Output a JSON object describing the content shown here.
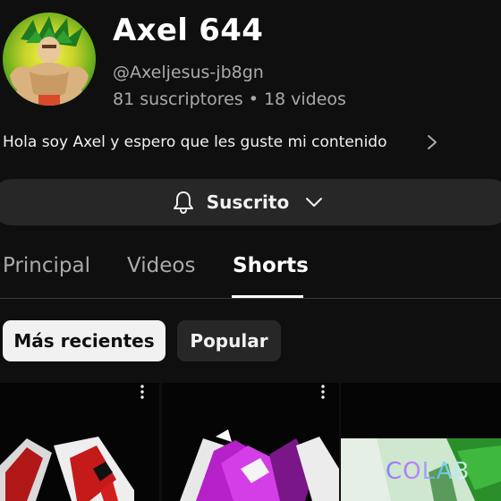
{
  "channel": {
    "name": "Axel 644",
    "handle": "@Axeljesus-jb8gn",
    "subscribers": "81 suscriptores",
    "separator": "•",
    "videos": "18 videos",
    "description": "Hola soy Axel y espero que les guste mi contenido"
  },
  "subscribe": {
    "label": "Suscrito"
  },
  "tabs": [
    {
      "label": "Principal"
    },
    {
      "label": "Videos"
    },
    {
      "label": "Shorts"
    }
  ],
  "active_tab": "Shorts",
  "filters": [
    {
      "label": "Más recientes",
      "selected": true
    },
    {
      "label": "Popular",
      "selected": false
    }
  ],
  "shorts": [
    {
      "overlay_text": ""
    },
    {
      "overlay_text": ""
    },
    {
      "overlay_text": "COLAB"
    }
  ],
  "icons": {
    "avatar": "avatar-image",
    "description_more": "chevron-right-icon",
    "notifications": "bell-icon",
    "subscribe_menu": "chevron-down-icon",
    "short_menu": "more-vert-icon"
  },
  "colors": {
    "background": "#0f0f0f",
    "button_bg": "#272727",
    "text_primary": "#f1f1f1",
    "text_secondary": "#aaaaaa",
    "chip_selected_bg": "#f1f1f1"
  }
}
